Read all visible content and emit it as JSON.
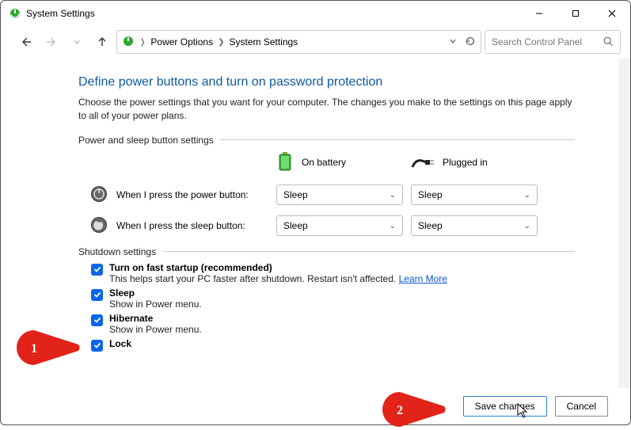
{
  "window": {
    "title": "System Settings"
  },
  "breadcrumb": {
    "item1": "Power Options",
    "item2": "System Settings"
  },
  "search": {
    "placeholder": "Search Control Panel"
  },
  "page": {
    "heading": "Define power buttons and turn on password protection",
    "description": "Choose the power settings that you want for your computer. The changes you make to the settings on this page apply to all of your power plans."
  },
  "section_power_sleep": {
    "legend": "Power and sleep button settings",
    "col_on_battery": "On battery",
    "col_plugged_in": "Plugged in",
    "row_power_label": "When I press the power button:",
    "row_power_battery_value": "Sleep",
    "row_power_plugged_value": "Sleep",
    "row_sleep_label": "When I press the sleep button:",
    "row_sleep_battery_value": "Sleep",
    "row_sleep_plugged_value": "Sleep"
  },
  "section_shutdown": {
    "legend": "Shutdown settings",
    "items": [
      {
        "title": "Turn on fast startup (recommended)",
        "desc_prefix": "This helps start your PC faster after shutdown. Restart isn't affected. ",
        "learn": "Learn More"
      },
      {
        "title": "Sleep",
        "desc": "Show in Power menu."
      },
      {
        "title": "Hibernate",
        "desc": "Show in Power menu."
      },
      {
        "title": "Lock"
      }
    ]
  },
  "footer": {
    "save": "Save changes",
    "cancel": "Cancel"
  },
  "annotations": {
    "num1": "1",
    "num2": "2"
  }
}
